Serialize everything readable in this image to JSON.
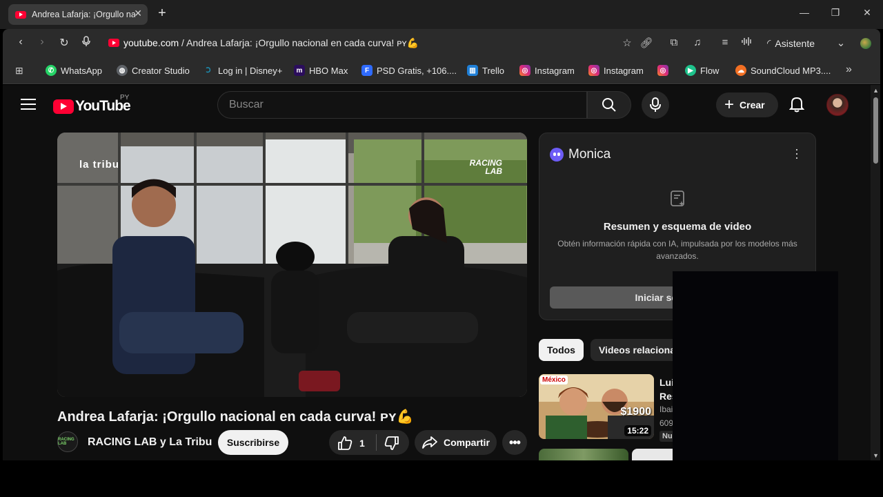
{
  "browser": {
    "tab_title": "Andrea Lafarja: ¡Orgullo nacio",
    "url_host": "youtube.com",
    "url_path": " / Andrea Lafarja: ¡Orgullo nacional en cada curva! ᴘʏ💪",
    "assistant_label": "Asistente",
    "bookmarks": [
      {
        "label": "WhatsApp",
        "icon": "whatsapp-icon",
        "color": "#25d366"
      },
      {
        "label": "Creator Studio",
        "icon": "globe-icon",
        "color": "#9aa0a6"
      },
      {
        "label": "Log in | Disney+",
        "icon": "disney-icon",
        "color": "#1d8fb4"
      },
      {
        "label": "HBO Max",
        "icon": "hbo-icon",
        "color": "#5a1fa8"
      },
      {
        "label": "PSD Gratis, +106....",
        "icon": "freepik-icon",
        "color": "#2f6bff"
      },
      {
        "label": "Trello",
        "icon": "trello-icon",
        "color": "#1f7fd6"
      },
      {
        "label": "Instagram",
        "icon": "instagram-icon",
        "color": "#e1306c"
      },
      {
        "label": "Instagram",
        "icon": "instagram-icon",
        "color": "#e1306c"
      },
      {
        "label": "",
        "icon": "instagram-icon",
        "color": "#e1306c"
      },
      {
        "label": "Flow",
        "icon": "flow-icon",
        "color": "#1ec28b"
      },
      {
        "label": "SoundCloud MP3....",
        "icon": "soundcloud-icon",
        "color": "#f26f23"
      }
    ]
  },
  "youtube": {
    "logo_text": "YouTube",
    "country_code": "PY",
    "search_placeholder": "Buscar",
    "create_label": "Crear",
    "video": {
      "title": "Andrea Lafarja: ¡Orgullo nacional en cada curva! ᴘʏ💪",
      "watermark_left": "la tribu",
      "watermark_right_1": "RACING",
      "watermark_right_2": "LAB",
      "channel_name": "RACING LAB y La Tribu",
      "channel_avatar_text": "RACING LAB",
      "subscribe_label": "Suscribirse",
      "like_count": "1",
      "share_label": "Compartir"
    },
    "monica": {
      "name": "Monica",
      "title": "Resumen y esquema de video",
      "description": "Obtén información rápida con IA, impulsada por los modelos más avanzados.",
      "button_label": "Iniciar sesión para"
    },
    "chips": [
      "Todos",
      "Videos relacionad"
    ],
    "recommendation": {
      "tag": "México",
      "price": "$1900",
      "duration": "15:22",
      "title_line1": "Lui",
      "title_line2": "Res",
      "channel": "Ibai",
      "views": "609",
      "badge": "Nu"
    }
  },
  "colors": {
    "youtube_red": "#ff0033",
    "page_bg": "#0f0f0f",
    "monica_accent": "#6d5cf6"
  }
}
